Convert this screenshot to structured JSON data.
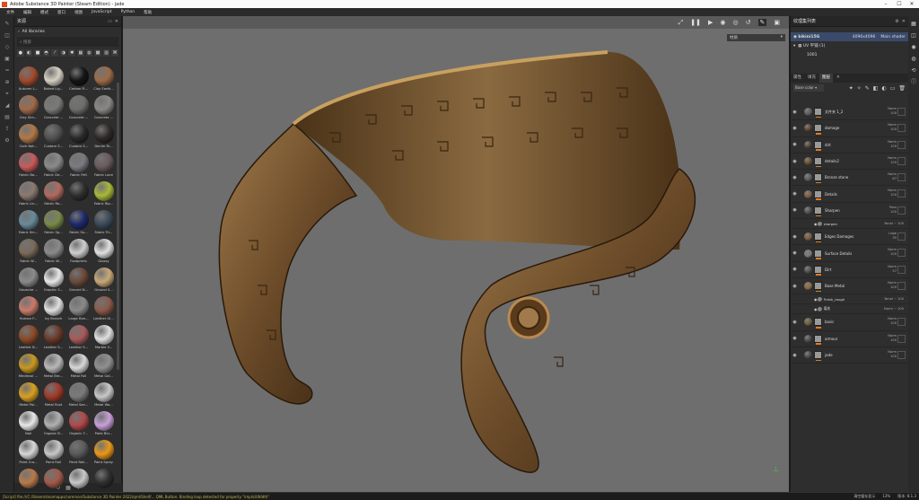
{
  "window": {
    "title": "Adobe Substance 3D Painter (Steam Edition) - jade"
  },
  "menu": [
    "文件",
    "编辑",
    "模式",
    "窗口",
    "视图",
    "JavaScript",
    "Python",
    "帮助"
  ],
  "shelf": {
    "title": "资源",
    "library": "All libraries",
    "search_placeholder": "搜索",
    "materials": [
      {
        "name": "Autumn L...",
        "color": "#a04a2e"
      },
      {
        "name": "Baked Lig...",
        "color": "#d6cfc2"
      },
      {
        "name": "Carbon Fi...",
        "color": "#151515"
      },
      {
        "name": "Clay Earth...",
        "color": "#9c6b48"
      },
      {
        "name": "Clay Sim...",
        "color": "#a06a4a"
      },
      {
        "name": "Concrete ...",
        "color": "#7a7a78"
      },
      {
        "name": "Concrete ...",
        "color": "#6e6e6c"
      },
      {
        "name": "Concrete ...",
        "color": "#8a8884"
      },
      {
        "name": "Cork Nat...",
        "color": "#b07848"
      },
      {
        "name": "Custom S...",
        "color": "#505050"
      },
      {
        "name": "Custom S...",
        "color": "#2a2a2a"
      },
      {
        "name": "Denim Ri...",
        "color": "#2e2a26"
      },
      {
        "name": "Fabric Ba...",
        "color": "#c85a5a"
      },
      {
        "name": "Fabric De...",
        "color": "#8a8a8a"
      },
      {
        "name": "Fabric Felt",
        "color": "#7a7a80"
      },
      {
        "name": "Fabric Lace",
        "color": "#6a5a5e"
      },
      {
        "name": "Fabric Lin...",
        "color": "#8a7a70"
      },
      {
        "name": "Fabric Ro...",
        "color": "#b06a60"
      },
      {
        "name": "",
        "color": "#2e2e2e"
      },
      {
        "name": "Fabric Rip...",
        "color": "#a8b83a"
      },
      {
        "name": "Fabric Sm...",
        "color": "#6a8a9a"
      },
      {
        "name": "Fabric Sp...",
        "color": "#7a8a4a"
      },
      {
        "name": "Fabric Su...",
        "color": "#1e2a6a"
      },
      {
        "name": "Fabric Tri...",
        "color": "#3a4a5a"
      },
      {
        "name": "Fabric W...",
        "color": "#7a6a5a"
      },
      {
        "name": "Fabric W...",
        "color": "#8a8a8a"
      },
      {
        "name": "Footprints",
        "color": "#cfcfcf"
      },
      {
        "name": "Glossy",
        "color": "#e0e0e0"
      },
      {
        "name": "Gouache ...",
        "color": "#8a8a8a"
      },
      {
        "name": "Graphic S...",
        "color": "#e8e8e8"
      },
      {
        "name": "Ground N...",
        "color": "#6a4a3a"
      },
      {
        "name": "Ground S...",
        "color": "#c8a878"
      },
      {
        "name": "Human F...",
        "color": "#c87a6a"
      },
      {
        "name": "Ivy Branch",
        "color": "#e0e0e0"
      },
      {
        "name": "Large Ran...",
        "color": "#8a8a8a"
      },
      {
        "name": "Leather Gl...",
        "color": "#8a5a4a"
      },
      {
        "name": "Leather B...",
        "color": "#8a4a2a"
      },
      {
        "name": "Leather S...",
        "color": "#6a3a2a"
      },
      {
        "name": "Leather S...",
        "color": "#a85a5a"
      },
      {
        "name": "Marble V...",
        "color": "#e0e0e0"
      },
      {
        "name": "Medieval ...",
        "color": "#c89820"
      },
      {
        "name": "Metal Bra...",
        "color": "#b8b8b8"
      },
      {
        "name": "Metal Foil",
        "color": "#d8d8d8"
      },
      {
        "name": "Metal Gal...",
        "color": "#909090"
      },
      {
        "name": "Metal Pol...",
        "color": "#d8a020"
      },
      {
        "name": "Metal Rust",
        "color": "#a03a2a"
      },
      {
        "name": "Metal San...",
        "color": "#7a7a7a"
      },
      {
        "name": "Metal Wo...",
        "color": "#c8c8c8"
      },
      {
        "name": "Nail",
        "color": "#e8e8e8"
      },
      {
        "name": "Organic B...",
        "color": "#b0b0b0"
      },
      {
        "name": "Organic T...",
        "color": "#b04a4a"
      },
      {
        "name": "Paint Blu...",
        "color": "#c8a0d8"
      },
      {
        "name": "Paint Cra...",
        "color": "#d8d8d8"
      },
      {
        "name": "Paint Roll",
        "color": "#c8c8c8"
      },
      {
        "name": "Paint Roll...",
        "color": "#5a5a5a"
      },
      {
        "name": "Paint Spray",
        "color": "#e89818"
      },
      {
        "name": "",
        "color": "#b87a4a"
      },
      {
        "name": "",
        "color": "#a05a4a"
      },
      {
        "name": "",
        "color": "#c8c8c8"
      },
      {
        "name": "",
        "color": "#2e2e2e"
      }
    ]
  },
  "viewport": {
    "mode": "材质"
  },
  "texture_set": {
    "title": "纹理集列表",
    "name": "bikini15G",
    "res": "4096x4096",
    "shader": "Main shader",
    "uv": "UV 平铺 (1)",
    "tile": "1001"
  },
  "tabs": [
    "属性",
    "填充",
    "图层"
  ],
  "blend_mode": "Base color",
  "layers": [
    {
      "name": "文件夹 1_2",
      "thumb": "#5a5a5a",
      "blend": "Norm",
      "op": "100",
      "sub": false
    },
    {
      "name": "damage",
      "thumb": "#5a3a2a",
      "blend": "Norm",
      "op": "100",
      "sub": false
    },
    {
      "name": "dirt",
      "thumb": "#4a3a2a",
      "blend": "Norm",
      "op": "100",
      "sub": false
    },
    {
      "name": "details2",
      "thumb": "#6a4a2a",
      "blend": "Norm",
      "op": "100",
      "sub": false
    },
    {
      "name": "Bronze stone",
      "thumb": "#5a5a5a",
      "blend": "Norm",
      "op": "87",
      "sub": false
    },
    {
      "name": "Details",
      "thumb": "#7a5a3a",
      "blend": "Norm",
      "op": "100",
      "sub": false
    },
    {
      "name": "Sharpen",
      "thumb": "#4a4a4a",
      "blend": "Pass",
      "op": "100",
      "sub": false
    },
    {
      "name": "sharpen",
      "thumb": "#888",
      "blend": "Nmal ~ 100",
      "op": "",
      "sub": true
    },
    {
      "name": "Edges Damages",
      "thumb": "#7a5a3a",
      "blend": "Ldge",
      "op": "35",
      "sub": false
    },
    {
      "name": "Surface Details",
      "thumb": "#777",
      "blend": "Norm",
      "op": "100",
      "sub": false
    },
    {
      "name": "Dirt",
      "thumb": "#4a4a4a",
      "blend": "Norm",
      "op": "57",
      "sub": false
    },
    {
      "name": "Base Metal",
      "thumb": "#8a6a3a",
      "blend": "Norm",
      "op": "100",
      "sub": false
    },
    {
      "name": "Finish_rough",
      "thumb": "#888",
      "blend": "Nmal ~ 100",
      "op": "",
      "sub": true
    },
    {
      "name": "填充",
      "thumb": "#888",
      "blend": "Norm ~ 100",
      "op": "",
      "sub": true
    },
    {
      "name": "basic",
      "thumb": "#6a5a3a",
      "blend": "Norm",
      "op": "100",
      "sub": false
    },
    {
      "name": "armour",
      "thumb": "#444",
      "blend": "Norm",
      "op": "100",
      "sub": false
    },
    {
      "name": "jade",
      "thumb": "#444",
      "blend": "Norm",
      "op": "100",
      "sub": false
    }
  ],
  "status": {
    "message": "[Script] file:///C:/Steam/steamapps/common/Substance 3D Painter 2022/qml/Shelf/... QML Button: Binding loop detected for property \"implicitWidth\"",
    "right1": "清空缓存显示",
    "right2": "13%",
    "right3": "版本: 8.1.3"
  },
  "colors": {
    "accent": "#e07a20",
    "viewport_bg": "#6e6e6e",
    "bronze": "#8a6a3a"
  }
}
